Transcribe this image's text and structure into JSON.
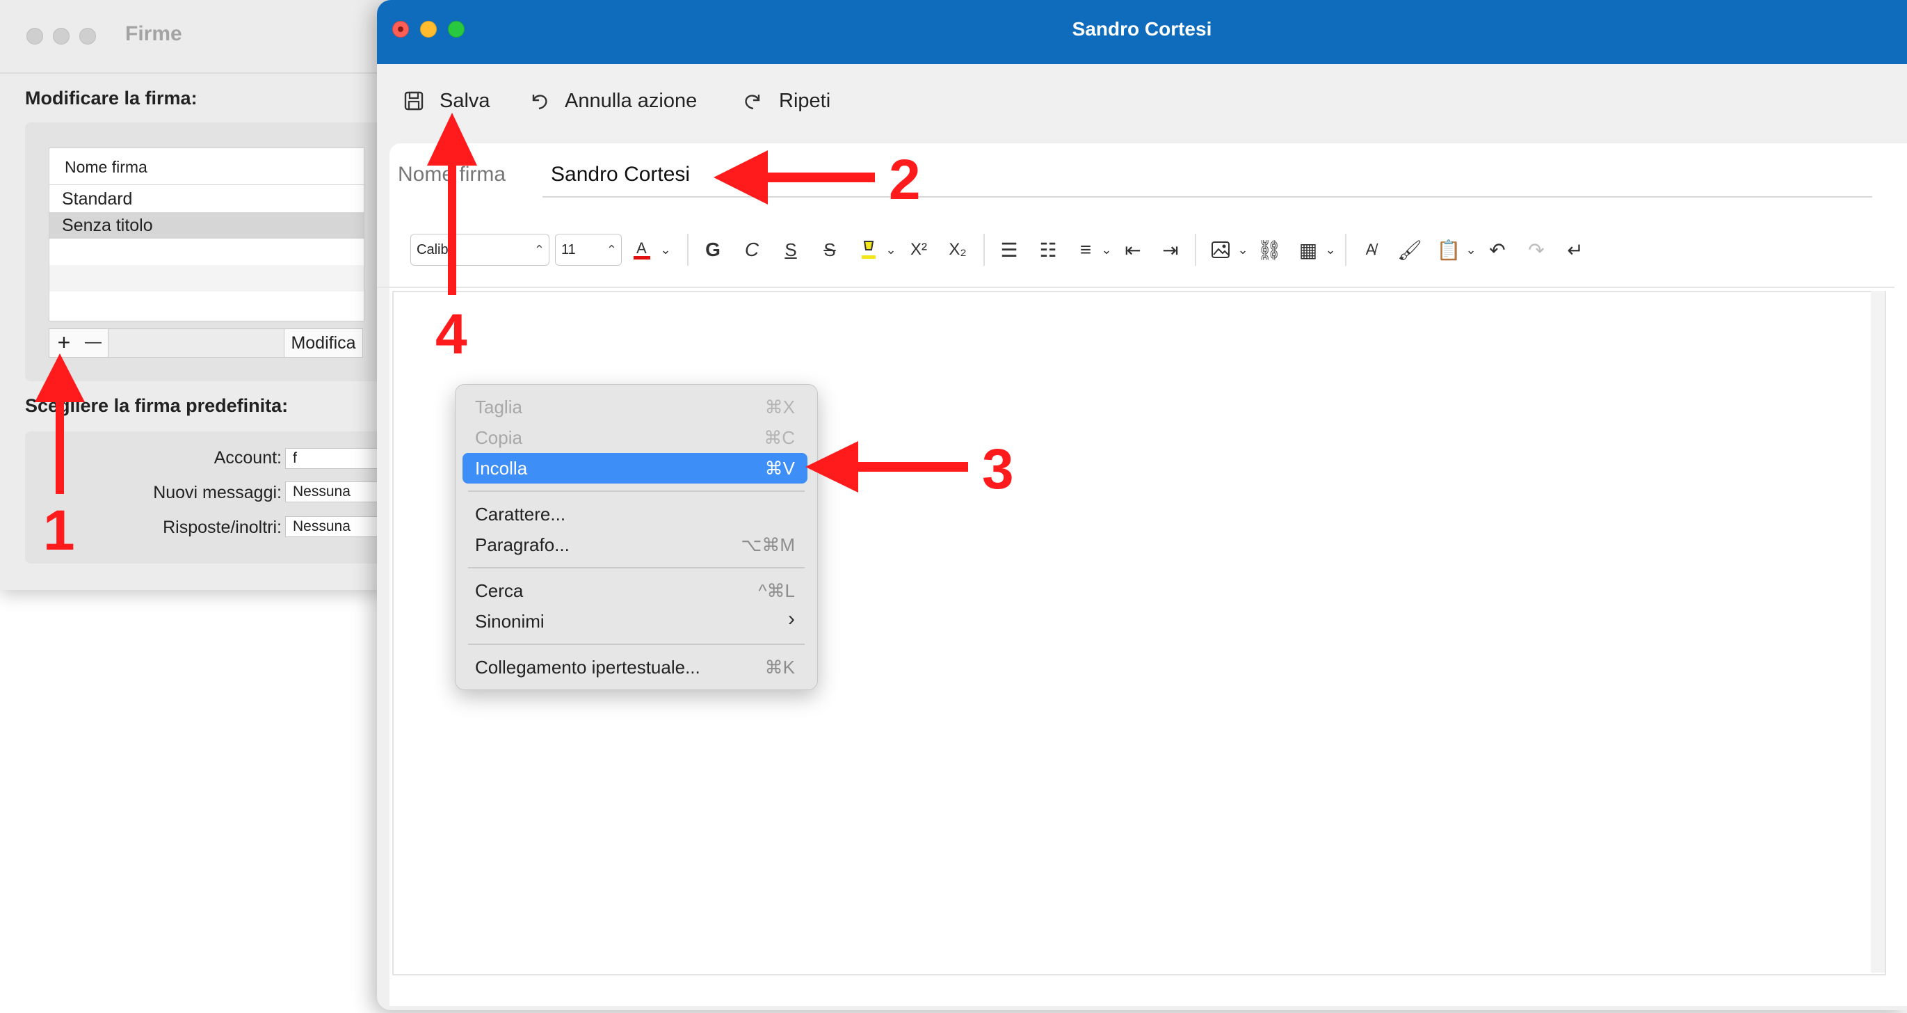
{
  "firme_window": {
    "title": "Firme",
    "edit_section_label": "Modificare la firma:",
    "table_header": "Nome firma",
    "signatures": [
      "Standard",
      "Senza titolo"
    ],
    "add_label": "+",
    "remove_label": "—",
    "edit_button_label": "Modifica",
    "default_section_label": "Scegliere la firma predefinita:",
    "account_label": "Account:",
    "account_value": "f",
    "new_messages_label": "Nuovi messaggi:",
    "new_messages_value": "Nessuna",
    "replies_label": "Risposte/inoltri:",
    "replies_value": "Nessuna"
  },
  "editor_window": {
    "title": "Sandro Cortesi",
    "toolbar": {
      "save_label": "Salva",
      "undo_label": "Annulla azione",
      "redo_label": "Ripeti"
    },
    "name_label": "Nome firma",
    "name_value": "Sandro Cortesi",
    "font_name": "Calibri",
    "font_size": "11",
    "colors": {
      "titlebar": "#0f6cbd",
      "font_color_bar": "#e01010",
      "highlight_color": "#f4e61a"
    },
    "format_icons": [
      "font-color-icon",
      "bold-icon",
      "italic-icon",
      "underline-icon",
      "strikethrough-icon",
      "highlight-icon",
      "superscript-icon",
      "subscript-icon",
      "bullet-list-icon",
      "numbered-list-icon",
      "align-icon",
      "decrease-indent-icon",
      "increase-indent-icon",
      "insert-picture-icon",
      "link-icon",
      "table-icon",
      "format-painter-icon",
      "clear-format-icon",
      "paste-icon",
      "undo-icon",
      "redo-icon",
      "line-break-icon"
    ]
  },
  "context_menu": {
    "items": [
      {
        "label": "Taglia",
        "shortcut": "⌘X"
      },
      {
        "label": "Copia",
        "shortcut": "⌘C"
      },
      {
        "label": "Incolla",
        "shortcut": "⌘V"
      },
      {
        "label": "Carattere...",
        "shortcut": ""
      },
      {
        "label": "Paragrafo...",
        "shortcut": "⌥⌘M"
      },
      {
        "label": "Cerca",
        "shortcut": "^⌘L"
      },
      {
        "label": "Sinonimi",
        "shortcut": "›"
      },
      {
        "label": "Collegamento ipertestuale...",
        "shortcut": "⌘K"
      }
    ]
  },
  "annotations": {
    "step1": "1",
    "step2": "2",
    "step3": "3",
    "step4": "4",
    "arrow_color": "#ff1b1b"
  }
}
